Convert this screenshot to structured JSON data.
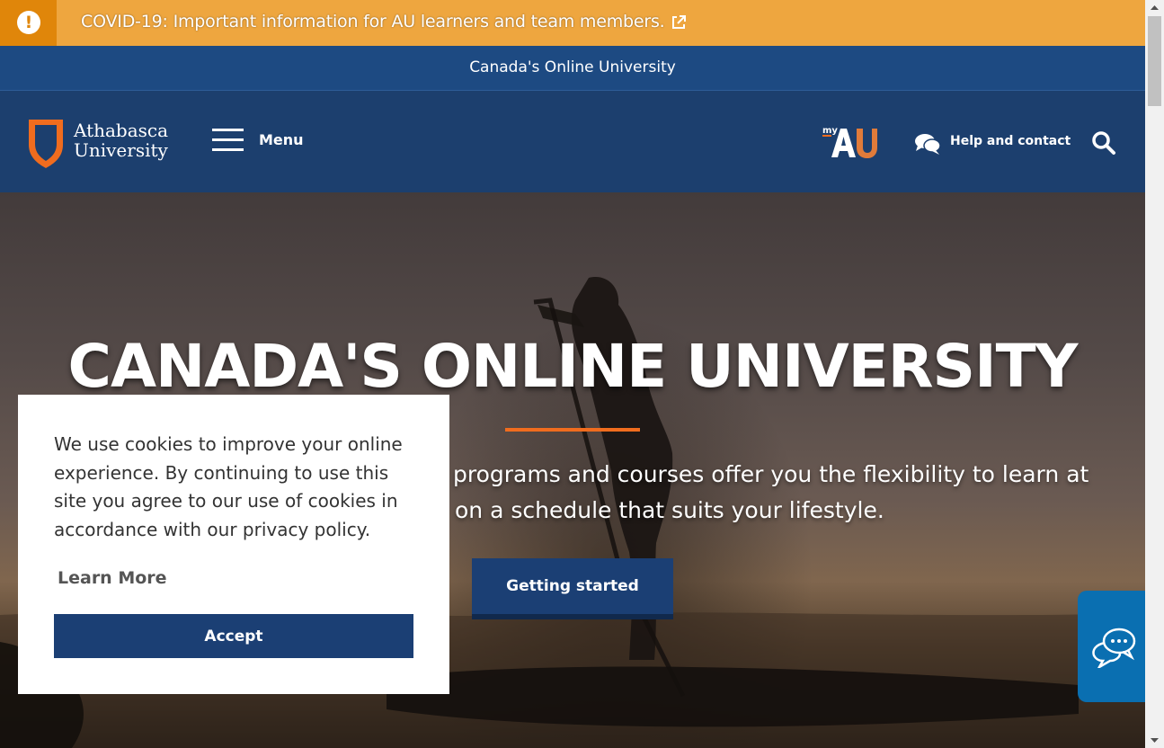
{
  "alert": {
    "text": "COVID-19: Important information for AU learners and team members.",
    "icon": "exclamation-circle-icon",
    "link_icon": "external-link-icon"
  },
  "tagline": {
    "text": "Canada's Online University"
  },
  "header": {
    "logo_line1": "Athabasca",
    "logo_line2": "University",
    "menu_label": "Menu",
    "myau_small": "my",
    "myau_big": "AU",
    "help_label": "Help and contact",
    "search_icon": "search-icon"
  },
  "hero": {
    "title": "CANADA'S ONLINE UNIVERSITY",
    "subtitle_line1": "programs and courses offer you the flexibility to learn at",
    "subtitle_line2": "on a schedule that suits your lifestyle.",
    "cta_label": "Getting started"
  },
  "cookie": {
    "message": "We use cookies to improve your online experience. By continuing to use this site you agree to our use of cookies in accordance with our privacy policy.",
    "learn_more": "Learn More",
    "accept": "Accept"
  },
  "chat": {
    "icon": "chat-bubbles-icon"
  },
  "colors": {
    "alert_bg": "#eea63f",
    "alert_icon_bg": "#e0860a",
    "navy": "#1c3f6e",
    "tagline_bg": "#1d4a82",
    "accent_orange": "#f06c1e",
    "button_navy": "#1b3f74",
    "chat_blue": "#0a6fb1"
  }
}
